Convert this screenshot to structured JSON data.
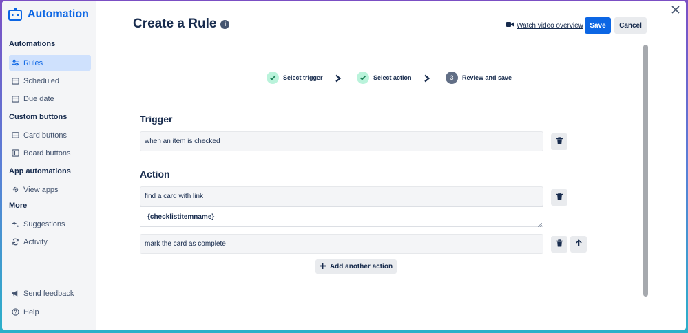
{
  "app": {
    "title": "Automation",
    "brand_color": "#0c66e4"
  },
  "sidebar": {
    "sections": [
      {
        "label": "Automations"
      },
      {
        "label": "Custom buttons"
      },
      {
        "label": "App automations"
      },
      {
        "label": "More"
      }
    ],
    "items": [
      {
        "label": "Rules",
        "icon": "sliders-icon",
        "active": true
      },
      {
        "label": "Scheduled",
        "icon": "calendar-icon",
        "active": false
      },
      {
        "label": "Due date",
        "icon": "calendar-icon",
        "active": false
      },
      {
        "label": "Card buttons",
        "icon": "card-icon",
        "active": false
      },
      {
        "label": "Board buttons",
        "icon": "board-icon",
        "active": false
      },
      {
        "label": "View apps",
        "icon": "gear-icon",
        "active": false
      },
      {
        "label": "Suggestions",
        "icon": "sparkle-icon",
        "active": false
      },
      {
        "label": "Activity",
        "icon": "refresh-icon",
        "active": false
      }
    ],
    "footer": [
      {
        "label": "Send feedback",
        "icon": "megaphone-icon"
      },
      {
        "label": "Help",
        "icon": "help-icon"
      }
    ]
  },
  "header": {
    "title": "Create a Rule",
    "info_glyph": "i",
    "video_link": "Watch video overview",
    "save_label": "Save",
    "cancel_label": "Cancel"
  },
  "steps": [
    {
      "label": "Select trigger",
      "state": "done"
    },
    {
      "label": "Select action",
      "state": "done"
    },
    {
      "label": "Review and save",
      "state": "current",
      "number": "3"
    }
  ],
  "trigger": {
    "heading": "Trigger",
    "value": "when an item is checked"
  },
  "action": {
    "heading": "Action",
    "items": [
      {
        "text": "find a card with link",
        "input_value": "{checklistitemname}"
      },
      {
        "text": "mark the card as complete"
      }
    ],
    "add_label": "Add another action"
  },
  "colors": {
    "primary": "#0c66e4",
    "step_done_bg": "#baf3db",
    "step_current_bg": "#626f86",
    "sidebar_active_bg": "#cfe1fd"
  }
}
